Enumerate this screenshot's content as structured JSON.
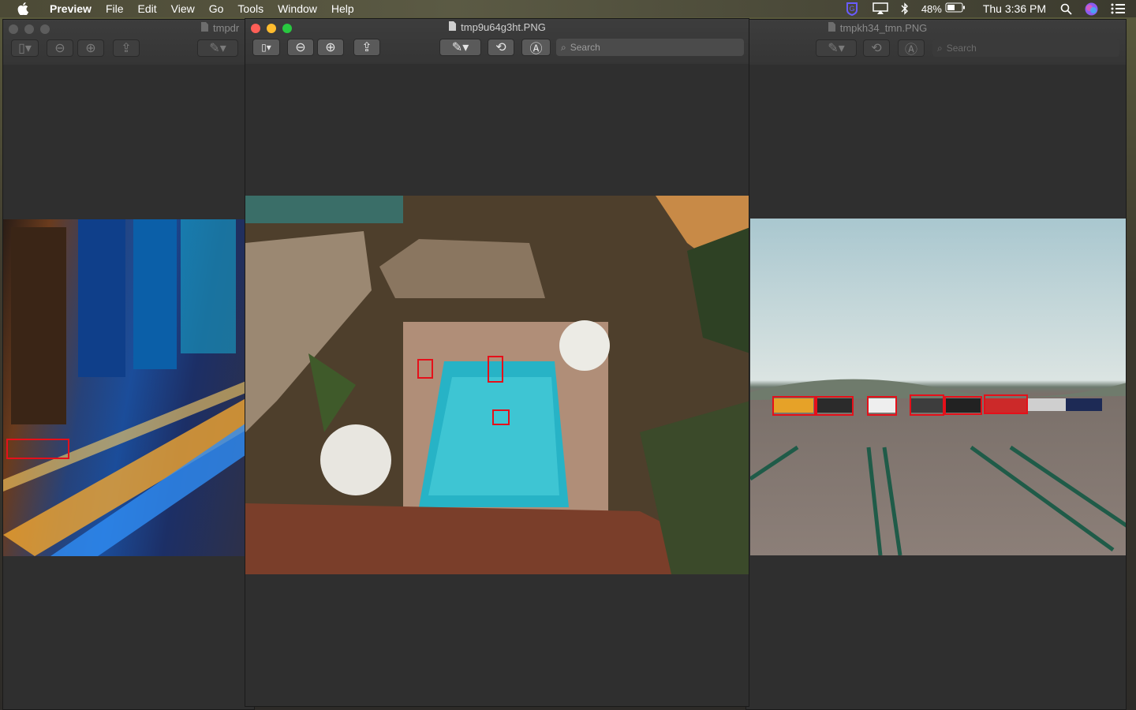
{
  "menubar": {
    "app_name": "Preview",
    "items": [
      "File",
      "Edit",
      "View",
      "Go",
      "Tools",
      "Window",
      "Help"
    ],
    "battery": "48%",
    "clock": "Thu 3:36 PM"
  },
  "windows": {
    "left": {
      "title": "tmpdr"
    },
    "center": {
      "title": "tmp9u64g3ht.PNG",
      "search_placeholder": "Search"
    },
    "right": {
      "title": "tmpkh34_tmn.PNG",
      "search_placeholder": "Search"
    }
  },
  "colors": {
    "bbox": "#e5101a",
    "close": "#ff5f57",
    "minimize": "#febc2e",
    "zoom": "#28c840",
    "inactive_dot": "#5d5d5d"
  },
  "icons": [
    "apple-icon",
    "grammarly-icon",
    "airplay-icon",
    "bluetooth-icon",
    "battery-icon",
    "spotlight-icon",
    "siri-icon",
    "control-center-icon",
    "sidebar-toggle-icon",
    "zoom-out-icon",
    "zoom-in-icon",
    "share-icon",
    "markup-pen-icon",
    "rotate-icon",
    "annotate-icon",
    "search-icon",
    "document-icon"
  ]
}
